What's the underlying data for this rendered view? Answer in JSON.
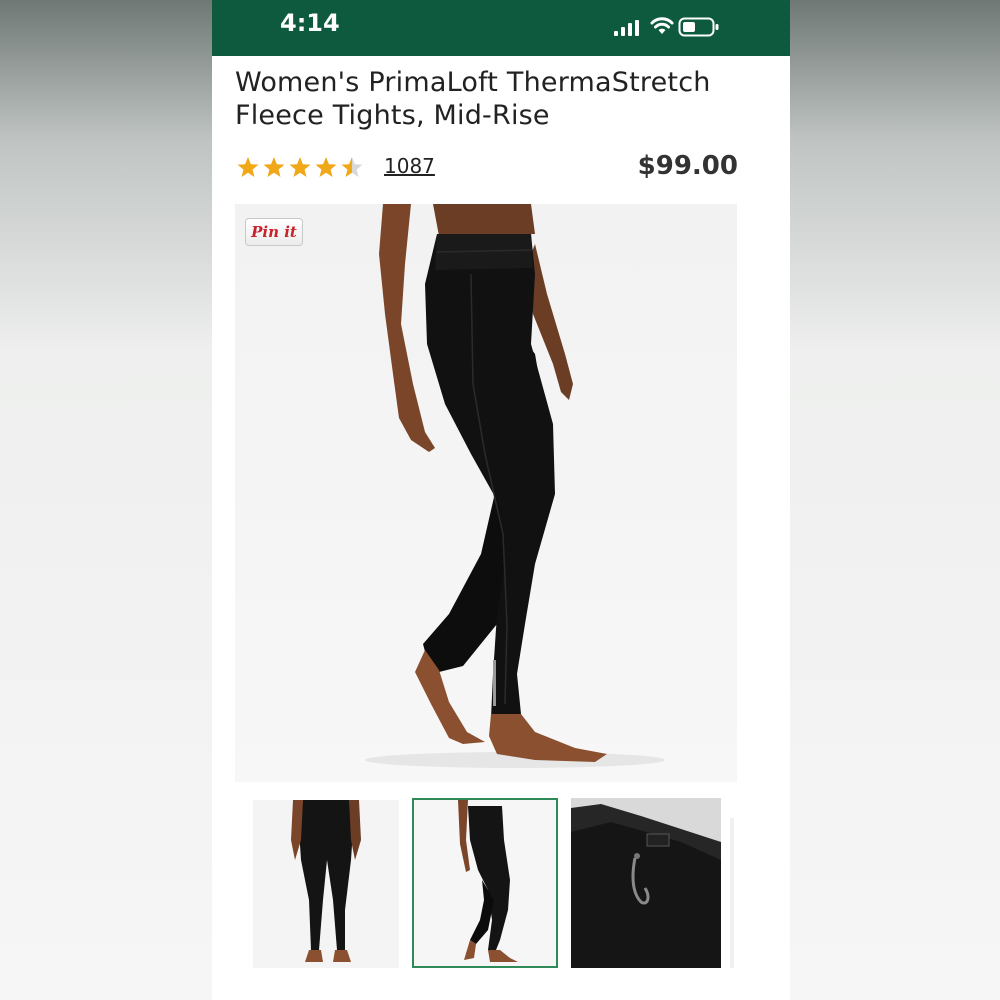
{
  "status_bar": {
    "time": "4:14",
    "background": "#0d5a3f"
  },
  "product": {
    "title": "Women's PrimaLoft ThermaStretch Fleece Tights, Mid-Rise",
    "rating": 4.5,
    "review_count": "1087",
    "price": "$99.00"
  },
  "image": {
    "pin_label": "Pin it"
  },
  "thumbnails": [
    {
      "label": "back view",
      "selected": false
    },
    {
      "label": "side view",
      "selected": true
    },
    {
      "label": "waistband detail",
      "selected": false
    }
  ],
  "colors": {
    "star": "#f0a818",
    "accent_green": "#2e8b57",
    "pin_red": "#c8232c"
  }
}
